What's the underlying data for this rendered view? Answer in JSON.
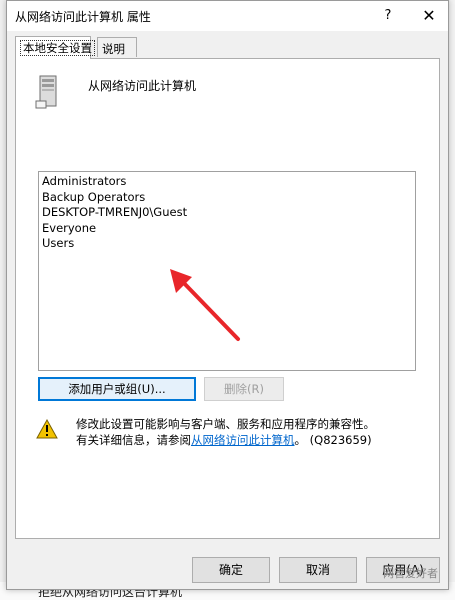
{
  "window": {
    "title": "从网络访问此计算机 属性",
    "help_label": "?",
    "close_label": "✕"
  },
  "tabs": [
    {
      "label": "本地安全设置",
      "active": true
    },
    {
      "label": "说明",
      "active": false
    }
  ],
  "policy": {
    "name": "从网络访问此计算机",
    "icon": "server-icon"
  },
  "members": [
    "Administrators",
    "Backup Operators",
    "DESKTOP-TMRENJ0\\Guest",
    "Everyone",
    "Users"
  ],
  "buttons": {
    "add": "添加用户或组(U)...",
    "remove": "删除(R)"
  },
  "warning": {
    "icon": "warning-icon",
    "line1": "修改此设置可能影响与客户端、服务和应用程序的兼容性。",
    "line2_prefix": "有关详细信息，请参阅",
    "line2_link": "从网络访问此计算机",
    "line2_suffix": "。 (Q823659)"
  },
  "footer": {
    "ok": "确定",
    "cancel": "取消",
    "apply": "应用(A)"
  },
  "watermark": "网管爱好者",
  "background": {
    "bottom_text": "拒绝从网络访问这台计算机"
  },
  "colors": {
    "accent": "#0078d7",
    "link": "#0066cc",
    "arrow": "#e8262a",
    "warning": "#f2c200"
  }
}
